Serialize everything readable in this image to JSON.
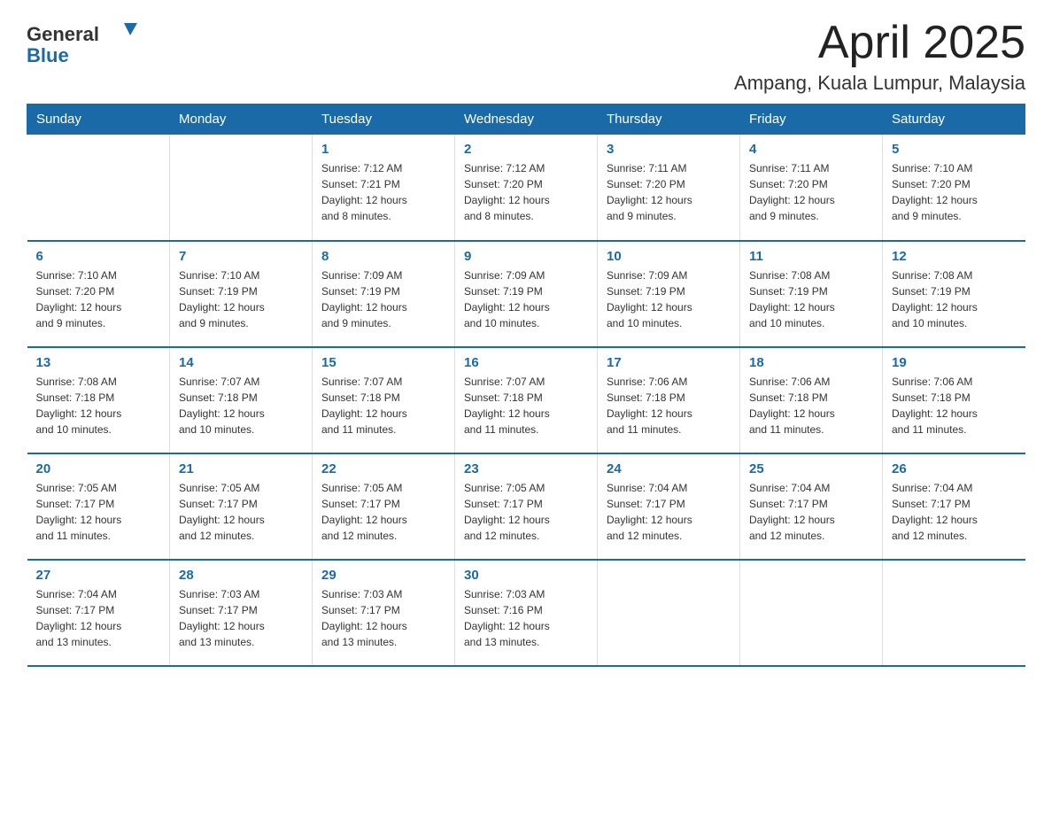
{
  "logo": {
    "general": "General",
    "blue": "Blue"
  },
  "header": {
    "title": "April 2025",
    "location": "Ampang, Kuala Lumpur, Malaysia"
  },
  "weekdays": [
    "Sunday",
    "Monday",
    "Tuesday",
    "Wednesday",
    "Thursday",
    "Friday",
    "Saturday"
  ],
  "weeks": [
    [
      {
        "day": "",
        "info": ""
      },
      {
        "day": "",
        "info": ""
      },
      {
        "day": "1",
        "info": "Sunrise: 7:12 AM\nSunset: 7:21 PM\nDaylight: 12 hours\nand 8 minutes."
      },
      {
        "day": "2",
        "info": "Sunrise: 7:12 AM\nSunset: 7:20 PM\nDaylight: 12 hours\nand 8 minutes."
      },
      {
        "day": "3",
        "info": "Sunrise: 7:11 AM\nSunset: 7:20 PM\nDaylight: 12 hours\nand 9 minutes."
      },
      {
        "day": "4",
        "info": "Sunrise: 7:11 AM\nSunset: 7:20 PM\nDaylight: 12 hours\nand 9 minutes."
      },
      {
        "day": "5",
        "info": "Sunrise: 7:10 AM\nSunset: 7:20 PM\nDaylight: 12 hours\nand 9 minutes."
      }
    ],
    [
      {
        "day": "6",
        "info": "Sunrise: 7:10 AM\nSunset: 7:20 PM\nDaylight: 12 hours\nand 9 minutes."
      },
      {
        "day": "7",
        "info": "Sunrise: 7:10 AM\nSunset: 7:19 PM\nDaylight: 12 hours\nand 9 minutes."
      },
      {
        "day": "8",
        "info": "Sunrise: 7:09 AM\nSunset: 7:19 PM\nDaylight: 12 hours\nand 9 minutes."
      },
      {
        "day": "9",
        "info": "Sunrise: 7:09 AM\nSunset: 7:19 PM\nDaylight: 12 hours\nand 10 minutes."
      },
      {
        "day": "10",
        "info": "Sunrise: 7:09 AM\nSunset: 7:19 PM\nDaylight: 12 hours\nand 10 minutes."
      },
      {
        "day": "11",
        "info": "Sunrise: 7:08 AM\nSunset: 7:19 PM\nDaylight: 12 hours\nand 10 minutes."
      },
      {
        "day": "12",
        "info": "Sunrise: 7:08 AM\nSunset: 7:19 PM\nDaylight: 12 hours\nand 10 minutes."
      }
    ],
    [
      {
        "day": "13",
        "info": "Sunrise: 7:08 AM\nSunset: 7:18 PM\nDaylight: 12 hours\nand 10 minutes."
      },
      {
        "day": "14",
        "info": "Sunrise: 7:07 AM\nSunset: 7:18 PM\nDaylight: 12 hours\nand 10 minutes."
      },
      {
        "day": "15",
        "info": "Sunrise: 7:07 AM\nSunset: 7:18 PM\nDaylight: 12 hours\nand 11 minutes."
      },
      {
        "day": "16",
        "info": "Sunrise: 7:07 AM\nSunset: 7:18 PM\nDaylight: 12 hours\nand 11 minutes."
      },
      {
        "day": "17",
        "info": "Sunrise: 7:06 AM\nSunset: 7:18 PM\nDaylight: 12 hours\nand 11 minutes."
      },
      {
        "day": "18",
        "info": "Sunrise: 7:06 AM\nSunset: 7:18 PM\nDaylight: 12 hours\nand 11 minutes."
      },
      {
        "day": "19",
        "info": "Sunrise: 7:06 AM\nSunset: 7:18 PM\nDaylight: 12 hours\nand 11 minutes."
      }
    ],
    [
      {
        "day": "20",
        "info": "Sunrise: 7:05 AM\nSunset: 7:17 PM\nDaylight: 12 hours\nand 11 minutes."
      },
      {
        "day": "21",
        "info": "Sunrise: 7:05 AM\nSunset: 7:17 PM\nDaylight: 12 hours\nand 12 minutes."
      },
      {
        "day": "22",
        "info": "Sunrise: 7:05 AM\nSunset: 7:17 PM\nDaylight: 12 hours\nand 12 minutes."
      },
      {
        "day": "23",
        "info": "Sunrise: 7:05 AM\nSunset: 7:17 PM\nDaylight: 12 hours\nand 12 minutes."
      },
      {
        "day": "24",
        "info": "Sunrise: 7:04 AM\nSunset: 7:17 PM\nDaylight: 12 hours\nand 12 minutes."
      },
      {
        "day": "25",
        "info": "Sunrise: 7:04 AM\nSunset: 7:17 PM\nDaylight: 12 hours\nand 12 minutes."
      },
      {
        "day": "26",
        "info": "Sunrise: 7:04 AM\nSunset: 7:17 PM\nDaylight: 12 hours\nand 12 minutes."
      }
    ],
    [
      {
        "day": "27",
        "info": "Sunrise: 7:04 AM\nSunset: 7:17 PM\nDaylight: 12 hours\nand 13 minutes."
      },
      {
        "day": "28",
        "info": "Sunrise: 7:03 AM\nSunset: 7:17 PM\nDaylight: 12 hours\nand 13 minutes."
      },
      {
        "day": "29",
        "info": "Sunrise: 7:03 AM\nSunset: 7:17 PM\nDaylight: 12 hours\nand 13 minutes."
      },
      {
        "day": "30",
        "info": "Sunrise: 7:03 AM\nSunset: 7:16 PM\nDaylight: 12 hours\nand 13 minutes."
      },
      {
        "day": "",
        "info": ""
      },
      {
        "day": "",
        "info": ""
      },
      {
        "day": "",
        "info": ""
      }
    ]
  ]
}
